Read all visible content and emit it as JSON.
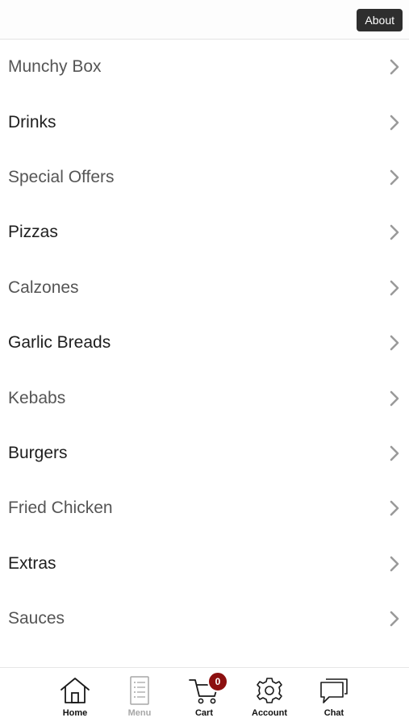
{
  "header": {
    "about_label": "About"
  },
  "menu": {
    "items": [
      {
        "label": "Munchy Box"
      },
      {
        "label": "Drinks"
      },
      {
        "label": "Special Offers"
      },
      {
        "label": "Pizzas"
      },
      {
        "label": "Calzones"
      },
      {
        "label": "Garlic Breads"
      },
      {
        "label": "Kebabs"
      },
      {
        "label": "Burgers"
      },
      {
        "label": "Fried Chicken"
      },
      {
        "label": "Extras"
      },
      {
        "label": "Sauces"
      }
    ],
    "chevron_icon": "chevron-right-icon"
  },
  "bottom_nav": {
    "items": [
      {
        "label": "Home",
        "icon": "home-icon",
        "active": true
      },
      {
        "label": "Menu",
        "icon": "menu-list-icon",
        "active": false
      },
      {
        "label": "Cart",
        "icon": "cart-icon",
        "active": true
      },
      {
        "label": "Account",
        "icon": "gear-icon",
        "active": true
      },
      {
        "label": "Chat",
        "icon": "chat-icon",
        "active": true
      }
    ],
    "cart_count": "0"
  },
  "colors": {
    "badge": "#8c0f0f",
    "about_bg": "#2e2e2e",
    "inactive_label": "#a7a7a7"
  }
}
